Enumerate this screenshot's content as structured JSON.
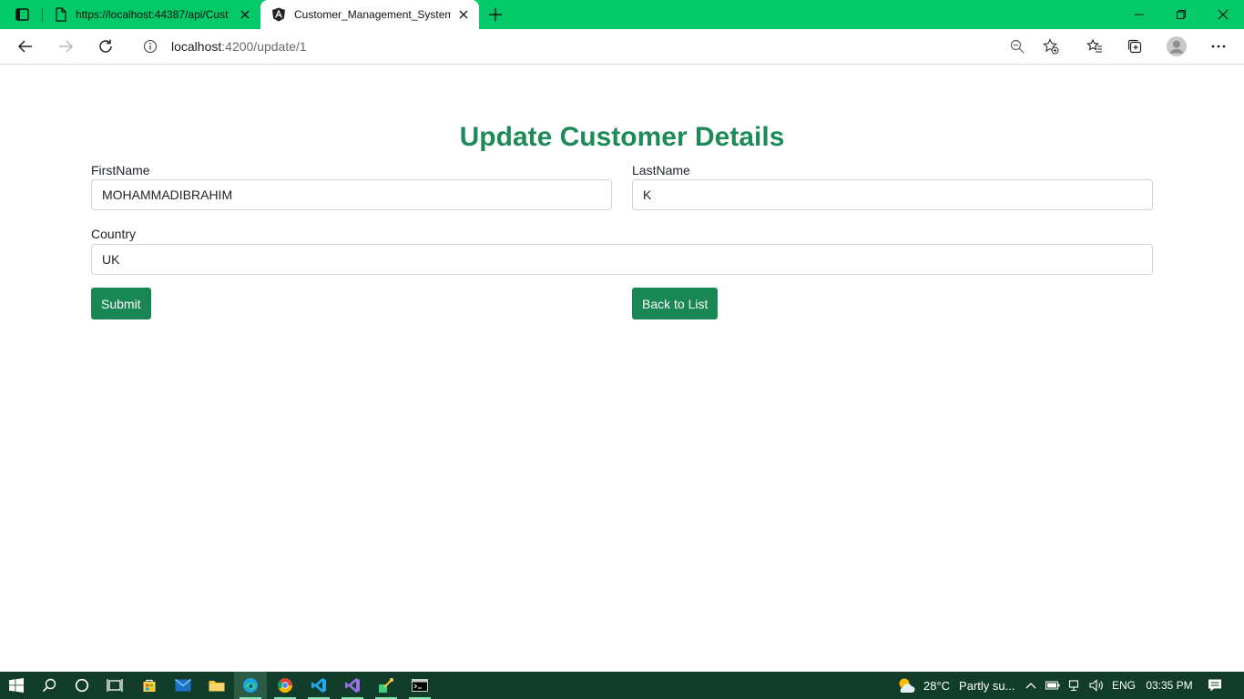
{
  "browser": {
    "tabs": [
      {
        "title": "https://localhost:44387/api/Cust",
        "icon": "document-icon"
      },
      {
        "title": "Customer_Management_System",
        "icon": "angular-icon"
      }
    ],
    "address": {
      "host": "localhost",
      "path": ":4200/update/1"
    }
  },
  "page": {
    "title": "Update Customer Details",
    "fields": {
      "firstname": {
        "label": "FirstName",
        "value": "MOHAMMADIBRAHIM"
      },
      "lastname": {
        "label": "LastName",
        "value": "K"
      },
      "country": {
        "label": "Country",
        "value": "UK"
      }
    },
    "buttons": {
      "submit": "Submit",
      "back": "Back to List"
    }
  },
  "taskbar": {
    "temperature": "28°C",
    "weather": "Partly su...",
    "language": "ENG",
    "time": "03:35 PM"
  },
  "colors": {
    "tabstrip": "#03c969",
    "accent": "#198754",
    "title": "#1e8a5a",
    "taskbar": "#123d2b"
  }
}
